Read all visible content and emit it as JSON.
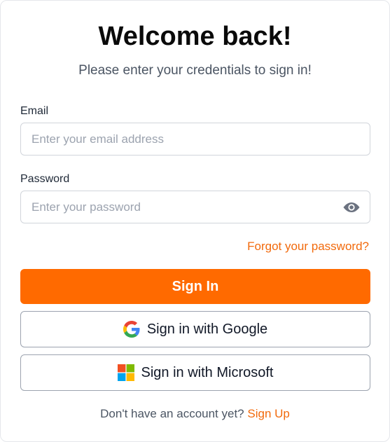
{
  "header": {
    "title": "Welcome back!",
    "subtitle": "Please enter your credentials to sign in!"
  },
  "email": {
    "label": "Email",
    "placeholder": "Enter your email address",
    "value": ""
  },
  "password": {
    "label": "Password",
    "placeholder": "Enter your password",
    "value": "",
    "toggle_icon": "eye-icon"
  },
  "forgot_link": "Forgot your password?",
  "buttons": {
    "sign_in": "Sign In",
    "google": "Sign in with Google",
    "google_icon": "google-logo-icon",
    "microsoft": "Sign in with Microsoft",
    "microsoft_icon": "microsoft-logo-icon"
  },
  "footer": {
    "prompt": "Don't have an account yet?",
    "signup_link": "Sign Up"
  },
  "colors": {
    "accent": "#ff6a00",
    "link": "#f26a0c",
    "title": "#0a0a0a",
    "muted_text": "#4b5563",
    "border": "#d1d5db"
  }
}
